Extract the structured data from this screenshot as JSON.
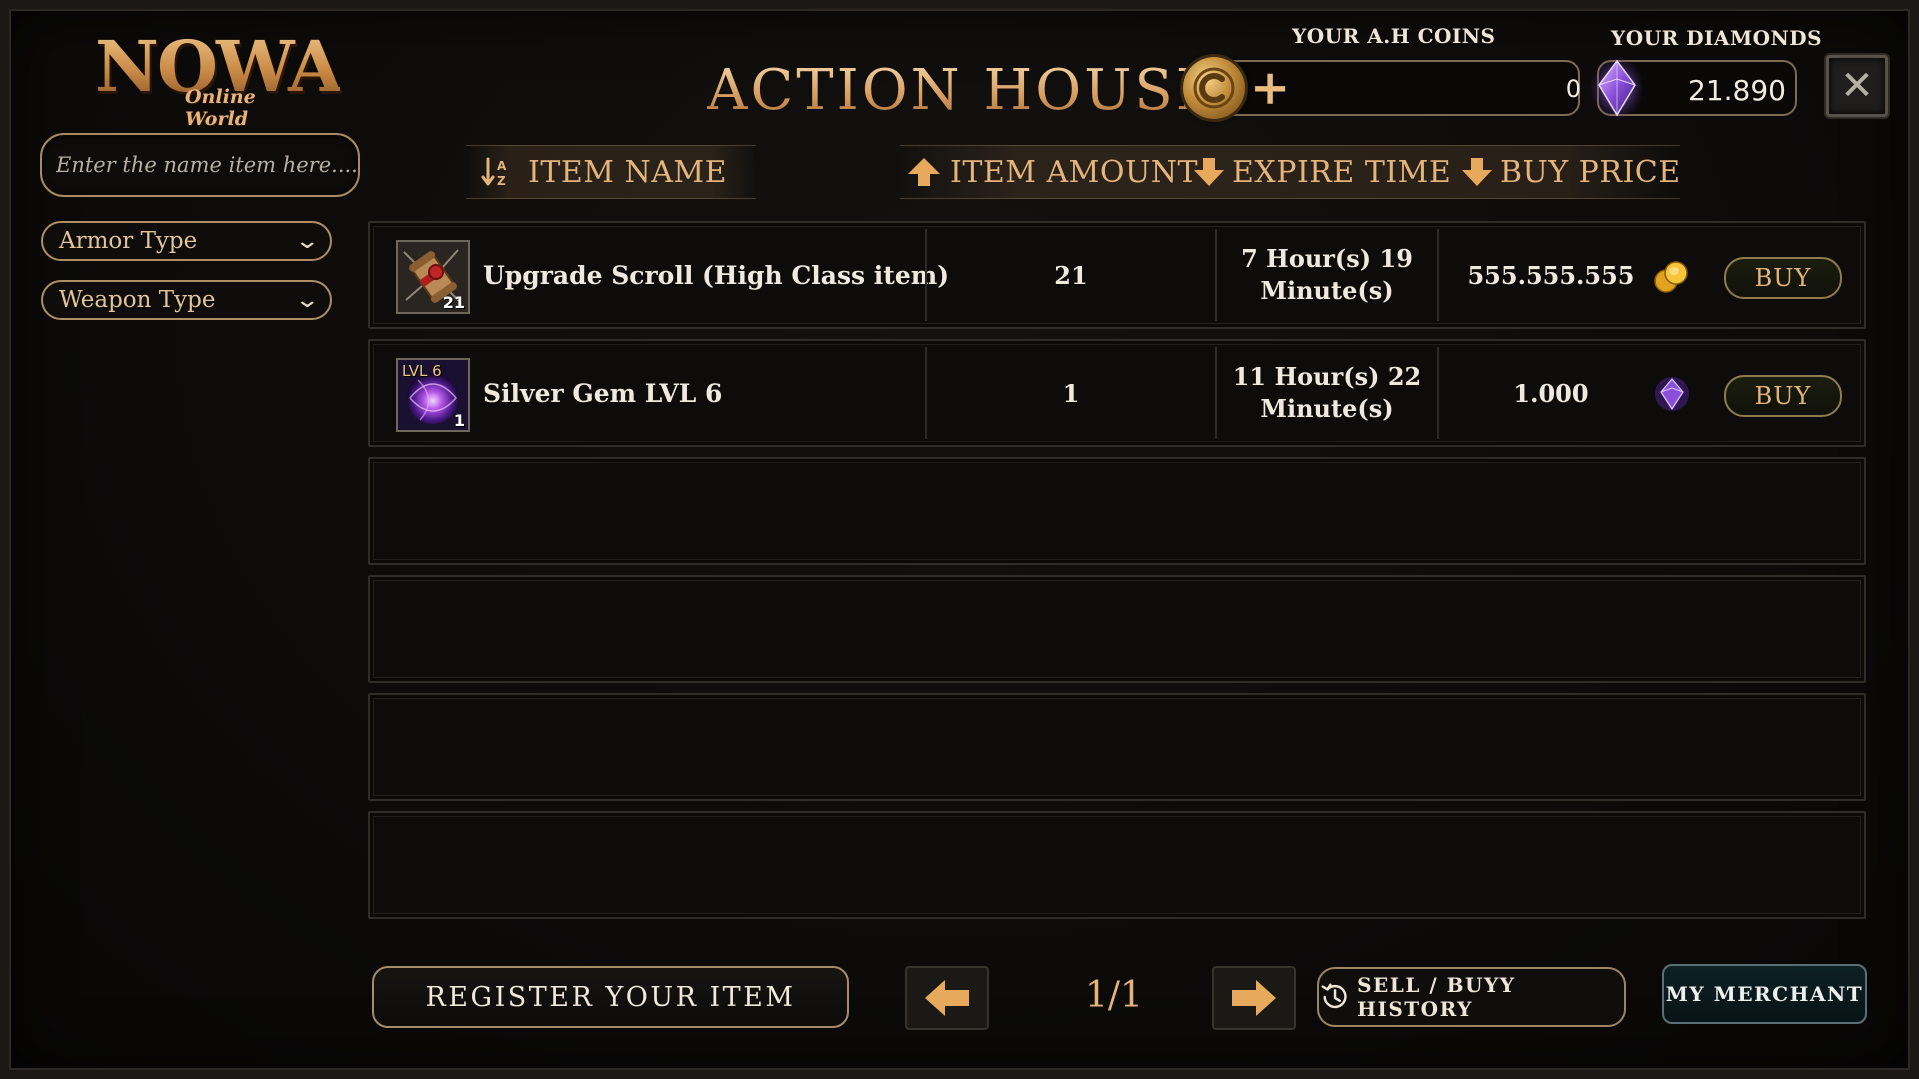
{
  "logo": {
    "main": "NOWA",
    "sub": "Online World"
  },
  "sidebar": {
    "search_placeholder": "Enter the name item here....",
    "filters": [
      {
        "label": "Armor Type"
      },
      {
        "label": "Weapon Type"
      }
    ]
  },
  "header": {
    "title": "ACTION HOUSE",
    "coins_label": "YOUR A.H COINS",
    "coins_value": "0",
    "coins_add": "+",
    "diamonds_label": "YOUR DIAMONDS",
    "diamonds_value": "21.890",
    "close_symbol": "✕"
  },
  "columns": {
    "item_name": "ITEM NAME",
    "item_amount": "ITEM AMOUNT",
    "expire_time": "EXPIRE TIME",
    "buy_price": "BUY PRICE",
    "sort_icon_text": "A Z"
  },
  "listings": [
    {
      "name": "Upgrade Scroll (High Class item)",
      "thumb_count": "21",
      "amount": "21",
      "expire_line1": "7 Hour(s) 19",
      "expire_line2": "Minute(s)",
      "price": "555.555.555",
      "currency": "coin-icon",
      "buy_label": "BUY"
    },
    {
      "name": "Silver Gem LVL 6",
      "thumb_lvl": "LVL 6",
      "thumb_count": "1",
      "amount": "1",
      "expire_line1": "11 Hour(s) 22",
      "expire_line2": "Minute(s)",
      "price": "1.000",
      "currency": "diamond-icon",
      "buy_label": "BUY"
    }
  ],
  "footer": {
    "register_label": "REGISTER YOUR ITEM",
    "page": "1/1",
    "history_label": "SELL / BUYY HISTORY",
    "merchant_label": "MY MERCHANT"
  },
  "colors": {
    "accent_gold": "#e3b47c",
    "diamond_purple": "#8a4fd8",
    "merchant_teal": "#0d2024"
  }
}
